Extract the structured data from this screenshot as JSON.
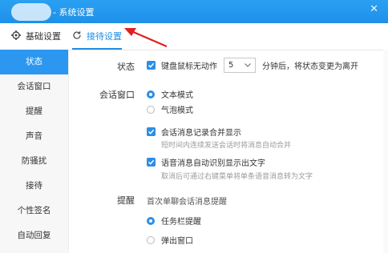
{
  "window": {
    "title": "- 系统设置",
    "close_glyph": "✕"
  },
  "topnav": {
    "tabs": [
      {
        "label": "基础设置",
        "icon": "gear-icon"
      },
      {
        "label": "接待设置",
        "icon": "refresh-icon",
        "active": true
      }
    ]
  },
  "sidebar": {
    "items": [
      {
        "label": "状态",
        "active": true
      },
      {
        "label": "会话窗口"
      },
      {
        "label": "提醒"
      },
      {
        "label": "声音"
      },
      {
        "label": "防骚扰"
      },
      {
        "label": "接待"
      },
      {
        "label": "个性签名"
      },
      {
        "label": "自动回复"
      }
    ]
  },
  "main": {
    "status": {
      "label": "状态",
      "idle_checkbox_label": "键盘鼠标无动作",
      "idle_minutes": "5",
      "idle_suffix": "分钟后，将状态变更为离开"
    },
    "chat_window": {
      "label": "会话窗口",
      "mode_text": "文本模式",
      "mode_bubble": "气泡模式",
      "merge_label": "会话消息记录合并显示",
      "merge_hint": "短时间内连续发送会话时将消息自动合并",
      "voice_label": "语音消息自动识别显示出文字",
      "voice_hint": "取消后可通过右键菜单将单条语音消息转为文字"
    },
    "reminder": {
      "label": "提醒",
      "desc": "首次单聊会话消息提醒",
      "taskbar": "任务栏提醒",
      "popup": "弹出窗口"
    }
  },
  "colors": {
    "accent": "#1f8ee6",
    "titlebar": "#1e90e8",
    "sidebar_active": "#2c97f0"
  }
}
